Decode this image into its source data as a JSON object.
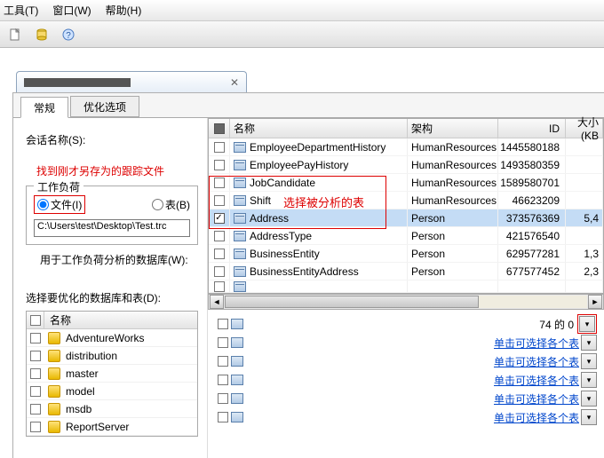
{
  "menu": {
    "tools": "工具(T)",
    "window": "窗口(W)",
    "help": "帮助(H)"
  },
  "tabs": {
    "general": "常规",
    "tuning": "优化选项"
  },
  "left": {
    "session_label": "会话名称(S):",
    "red_note": "找到刚才另存为的跟踪文件",
    "group_legend": "工作负荷",
    "radio_file": "文件(I)",
    "radio_table": "表(B)",
    "path": "C:\\Users\\test\\Desktop\\Test.trc",
    "db_for_analysis": "用于工作负荷分析的数据库(W):",
    "select_db_label": "选择要优化的数据库和表(D):",
    "col_name": "名称"
  },
  "databases": [
    {
      "name": "AdventureWorks"
    },
    {
      "name": "distribution"
    },
    {
      "name": "master"
    },
    {
      "name": "model"
    },
    {
      "name": "msdb"
    },
    {
      "name": "ReportServer"
    }
  ],
  "grid": {
    "headers": {
      "name": "名称",
      "schema": "架构",
      "id": "ID",
      "size": "大小(KB"
    },
    "red_overlay": "选择被分析的表",
    "rows": [
      {
        "name": "EmployeeDepartmentHistory",
        "schema": "HumanResources",
        "id": "1445580188",
        "size": "",
        "sel": false,
        "chk": false
      },
      {
        "name": "EmployeePayHistory",
        "schema": "HumanResources",
        "id": "1493580359",
        "size": "",
        "sel": false,
        "chk": false
      },
      {
        "name": "JobCandidate",
        "schema": "HumanResources",
        "id": "1589580701",
        "size": "",
        "sel": false,
        "chk": false
      },
      {
        "name": "Shift",
        "schema": "HumanResources",
        "id": "46623209",
        "size": "",
        "sel": false,
        "chk": false
      },
      {
        "name": "Address",
        "schema": "Person",
        "id": "373576369",
        "size": "5,4",
        "sel": true,
        "chk": true
      },
      {
        "name": "AddressType",
        "schema": "Person",
        "id": "421576540",
        "size": "",
        "sel": false,
        "chk": false
      },
      {
        "name": "BusinessEntity",
        "schema": "Person",
        "id": "629577281",
        "size": "1,3",
        "sel": false,
        "chk": false
      },
      {
        "name": "BusinessEntityAddress",
        "schema": "Person",
        "id": "677577452",
        "size": "2,3",
        "sel": false,
        "chk": false
      }
    ]
  },
  "lower": {
    "counter": "74 的 0",
    "link_text": "单击可选择各个表"
  }
}
